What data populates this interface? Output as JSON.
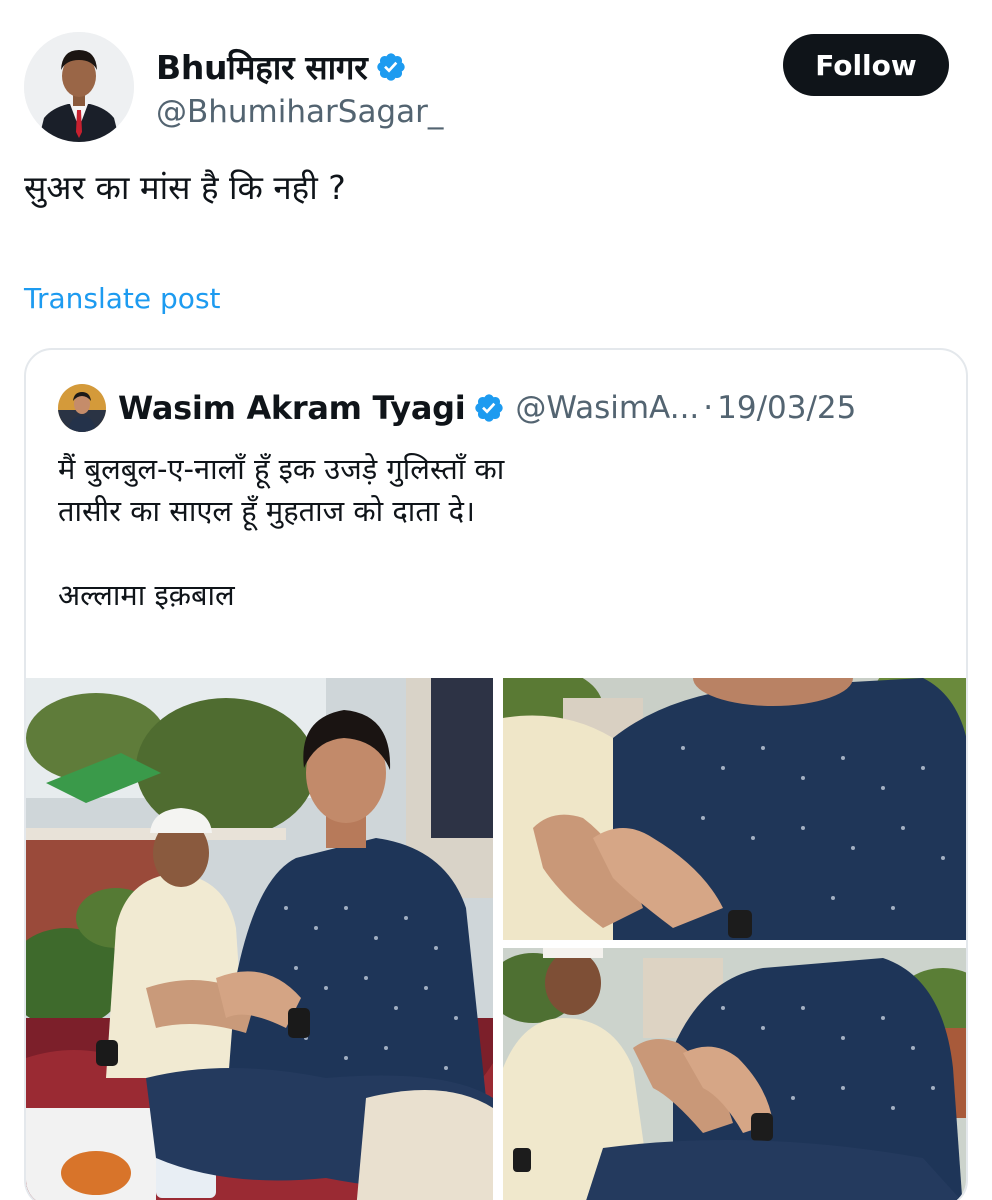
{
  "author": {
    "display_name": "Bhuमिहार सागर",
    "handle": "@BhumiharSagar_",
    "verified_icon": "verified-badge-icon"
  },
  "follow_label": "Follow",
  "post_text": "सुअर का मांस है कि नही ?",
  "translate_label": "Translate post",
  "quoted": {
    "display_name": "Wasim Akram Tyagi",
    "handle": "@WasimA...",
    "separator": "·",
    "date": "19/03/25",
    "text": "मैं बुलबुल-ए-नालाँ हूँ इक उजड़े गुलिस्ताँ का\nतासीर का साएल हूँ मुहताज को दाता दे।\n\nअल्लामा इक़बाल"
  },
  "colors": {
    "accent": "#1d9bf0",
    "text": "#0f1419",
    "secondary": "#536471",
    "follow_bg": "#0f1419"
  }
}
